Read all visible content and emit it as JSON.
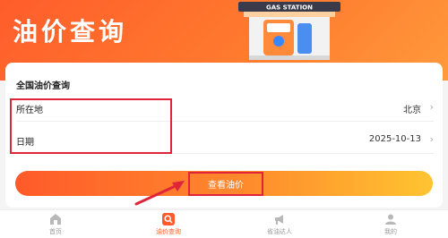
{
  "banner": {
    "title": "油价查询",
    "station_sign": "GAS STATION"
  },
  "card": {
    "title": "全国油价查询",
    "rows": [
      {
        "label": "所在地",
        "value": "北京",
        "chevron": "›"
      },
      {
        "label": "日期",
        "value": "2025-10-13",
        "chevron": "›"
      }
    ]
  },
  "action": {
    "query_label": "查看油价"
  },
  "tabbar": {
    "tabs": [
      {
        "label": "首页",
        "icon": "home-icon",
        "active": false
      },
      {
        "label": "油价查询",
        "icon": "search-icon",
        "active": true
      },
      {
        "label": "省油达人",
        "icon": "megaphone-icon",
        "active": false
      },
      {
        "label": "我的",
        "icon": "user-icon",
        "active": false
      }
    ]
  },
  "colors": {
    "accent": "#ff5a2a",
    "highlight": "#e0253a",
    "button_end": "#ffc431"
  }
}
